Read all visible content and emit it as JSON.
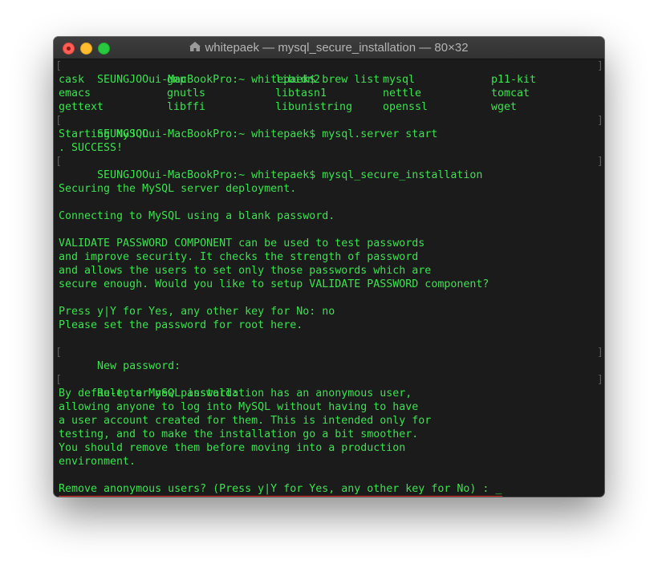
{
  "window": {
    "title": "whitepaek — mysql_secure_installation — 80×32"
  },
  "terminal": {
    "prompt1": "SEUNGJOOui-MacBookPro:~ whitepaek$ brew list",
    "brew_list": [
      [
        "cask",
        "gmp",
        "libidn2",
        "mysql",
        "p11-kit"
      ],
      [
        "emacs",
        "gnutls",
        "libtasn1",
        "nettle",
        "tomcat"
      ],
      [
        "gettext",
        "libffi",
        "libunistring",
        "openssl",
        "wget"
      ]
    ],
    "prompt2": "SEUNGJOOui-MacBookPro:~ whitepaek$ mysql.server start",
    "starting": "Starting MySQL",
    "success": ". SUCCESS!",
    "prompt3": "SEUNGJOOui-MacBookPro:~ whitepaek$ mysql_secure_installation",
    "securing": "Securing the MySQL server deployment.",
    "connecting": "Connecting to MySQL using a blank password.",
    "validate_lines": [
      "VALIDATE PASSWORD COMPONENT can be used to test passwords",
      "and improve security. It checks the strength of password",
      "and allows the users to set only those passwords which are",
      "secure enough. Would you like to setup VALIDATE PASSWORD component?"
    ],
    "press_yes": "Press y|Y for Yes, any other key for No: no",
    "set_password": "Please set the password for root here.",
    "new_password": "New password:",
    "reenter_password": "Re-enter new password:",
    "anon_lines": [
      "By default, a MySQL installation has an anonymous user,",
      "allowing anyone to log into MySQL without having to have",
      "a user account created for them. This is intended only for",
      "testing, and to make the installation go a bit smoother.",
      "You should remove them before moving into a production",
      "environment."
    ],
    "remove_anon": "Remove anonymous users? (Press y|Y for Yes, any other key for No) : _"
  },
  "colors": {
    "terminal_text": "#3be34e",
    "terminal_bg": "#1b1b1b",
    "highlight_underline": "#e0302a"
  }
}
